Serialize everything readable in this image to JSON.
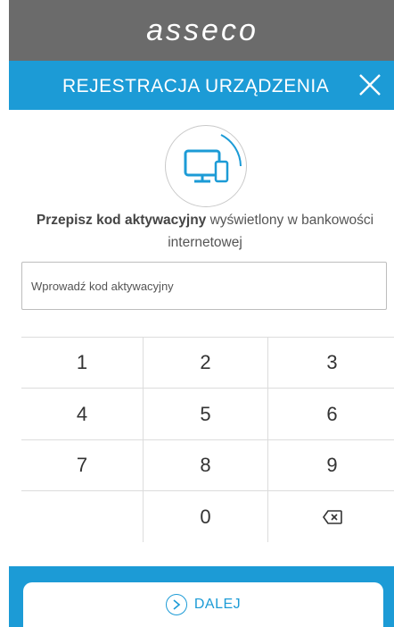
{
  "brand": {
    "logo_text": "asseco"
  },
  "header": {
    "title": "REJESTRACJA URZĄDZENIA",
    "close_icon": "close-icon"
  },
  "device_icon": "devices-icon",
  "instructions": {
    "bold": "Przepisz kod aktywacyjny",
    "rest": " wyświetlony w bankowości internetowej"
  },
  "code_field": {
    "value": "",
    "placeholder": "Wprowadź kod aktywacyjny"
  },
  "keypad": {
    "keys": [
      "1",
      "2",
      "3",
      "4",
      "5",
      "6",
      "7",
      "8",
      "9",
      "",
      "0"
    ],
    "backspace_icon": "backspace-icon"
  },
  "footer": {
    "next_label": "DALEJ",
    "next_icon": "chevron-right-circle-icon"
  },
  "colors": {
    "accent": "#1c9bd6",
    "brand_bar": "#6b6b6b",
    "divider": "#dcdcdc"
  }
}
